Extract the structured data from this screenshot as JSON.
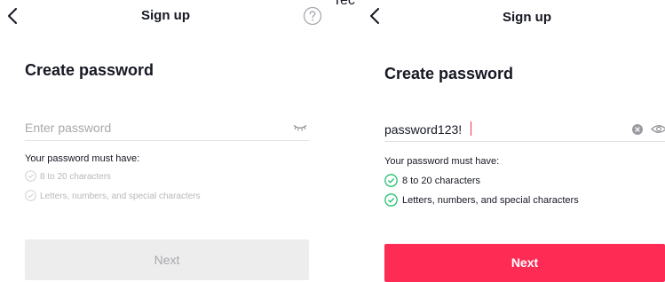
{
  "overlay_fragment": "Tec",
  "screens": [
    {
      "header": {
        "back_icon": "chevron-left-icon",
        "title": "Sign up",
        "help_icon": "help-circle-icon"
      },
      "title": "Create password",
      "password": {
        "value": "",
        "placeholder": "Enter password",
        "visibility_icon": "eye-closed-icon"
      },
      "requirements_title": "Your password must have:",
      "requirements": [
        {
          "label": "8 to 20 characters",
          "met": false
        },
        {
          "label": "Letters, numbers, and special characters",
          "met": false
        }
      ],
      "next_label": "Next",
      "next_enabled": false
    },
    {
      "header": {
        "back_icon": "chevron-left-icon",
        "title": "Sign up"
      },
      "title": "Create password",
      "password": {
        "value": "password123!",
        "clear_icon": "clear-circle-icon",
        "visibility_icon": "eye-open-icon"
      },
      "requirements_title": "Your password must have:",
      "requirements": [
        {
          "label": "8 to 20 characters",
          "met": true
        },
        {
          "label": "Letters, numbers, and special characters",
          "met": true
        }
      ],
      "next_label": "Next",
      "next_enabled": true
    }
  ],
  "colors": {
    "accent": "#fe2c55",
    "check_green": "#25c16f",
    "text": "#161823",
    "muted": "#a7a8ac",
    "disabled_button": "#ededed",
    "divider": "#e3e3e4"
  }
}
